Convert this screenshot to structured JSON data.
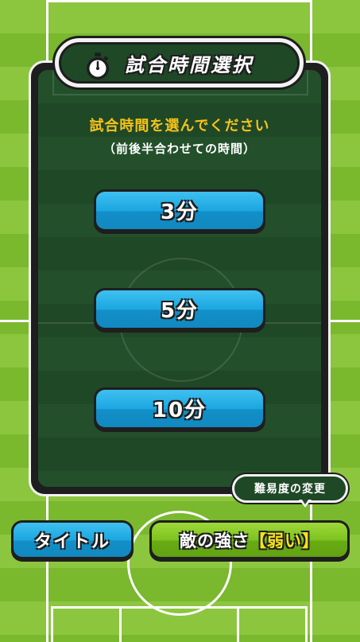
{
  "screen": {
    "title": "試合時間選択",
    "prompt": "試合時間を選んでください",
    "subprompt": "（前後半合わせての時間）"
  },
  "time_options": [
    {
      "label": "3分"
    },
    {
      "label": "5分"
    },
    {
      "label": "10分"
    }
  ],
  "bottom_bar": {
    "title_button": "タイトル",
    "enemy_strength_label": "敵の強さ",
    "enemy_strength_value": "【弱い】",
    "difficulty_hint": "難易度の変更"
  },
  "colors": {
    "field_green_light": "#8cc63f",
    "field_green_dark": "#7ab82e",
    "panel_green": "#23502b",
    "button_blue": "#1aa6e0",
    "button_green": "#7cc21e",
    "accent_yellow": "#f5c21a"
  },
  "icons": {
    "title_icon": "stopwatch-icon"
  }
}
